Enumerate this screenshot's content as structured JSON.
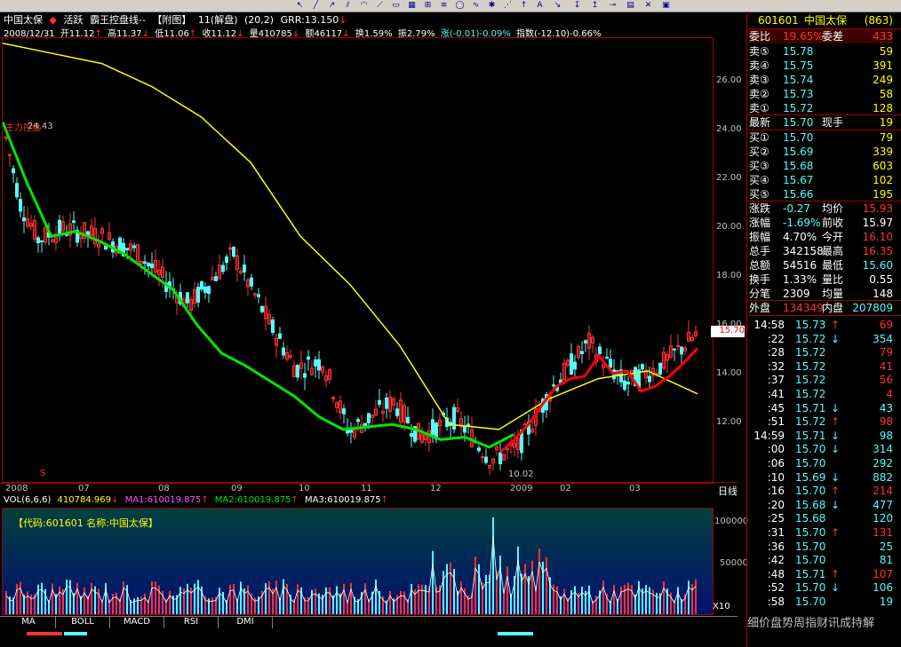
{
  "toolbar": {
    "icons": [
      "pointer-icon",
      "line-icon",
      "ray-icon",
      "channel-icon",
      "arc-icon",
      "fan-icon",
      "text-icon",
      "arrow-icon",
      "box-icon",
      "delete-icon",
      "save-icon"
    ]
  },
  "header": {
    "stock_name": "中国太保",
    "mode": "活跃",
    "indicator_name": "霸王控盘线--",
    "attached": "【附图】",
    "period_info": "11(解盘)",
    "params": "(20,2)",
    "grr": "GRR:13.150",
    "grr_arrow": "↓"
  },
  "info": {
    "date": "2008/12/31",
    "open": "开11.12",
    "open_arrow": "↑",
    "high": "高11.37",
    "high_arrow": "↓",
    "low": "低11.06",
    "low_arrow": "↑",
    "close": "收11.12",
    "close_arrow": "↓",
    "volume": "量410785",
    "volume_arrow": "↓",
    "amount": "额46117",
    "amount_arrow": "↓",
    "turnover": "换1.59%",
    "amplitude": "振2.79%",
    "change": "涨(-0.01)-0.09%",
    "index": "指数(-12.10)-0.66%"
  },
  "chart_marks": {
    "high_label": "24.43",
    "low_label": "10.02",
    "signal_text": "主力控盘",
    "last_price_tag": "15.70",
    "s_marker": "S"
  },
  "chart_data": {
    "type": "line",
    "ylim": [
      10.0,
      27.5
    ],
    "yticks": [
      "26.00",
      "24.00",
      "22.00",
      "20.00",
      "18.00",
      "16.00",
      "14.00",
      "12.00"
    ],
    "x_labels": [
      "2008",
      "07",
      "08",
      "09",
      "10",
      "11",
      "12",
      "2009",
      "02",
      "03",
      "日线"
    ],
    "series": [
      {
        "color": "#ffff00",
        "values": [
          27.3,
          26.9,
          26.5,
          25.6,
          24.4,
          22.6,
          19.7,
          17.8,
          15.4,
          12.3,
          12.1,
          13.3,
          14.1,
          14.4,
          13.5
        ]
      },
      {
        "color": "#00e600",
        "values": [
          24.2,
          21.8,
          19.7,
          19.9,
          19.5,
          19.0,
          18.3,
          17.6,
          16.2,
          15.1,
          14.6,
          14.0,
          13.4,
          12.6,
          12.1,
          12.2,
          12.3,
          12.1,
          11.7,
          11.8,
          11.4,
          11.9
        ]
      },
      {
        "color": "#ff0000",
        "values": [
          11.2,
          11.7,
          12.3,
          13.1,
          13.8,
          14.1,
          14.2,
          15.0,
          14.3,
          14.4,
          13.6,
          13.8,
          14.2,
          14.7,
          15.3
        ]
      }
    ]
  },
  "volume": {
    "title": "VOL(6,6,6)",
    "value": "410784.969",
    "value_arrow": "↓",
    "ma1": "MA1:610019.875",
    "ma1_arrow": "↑",
    "ma2": "MA2:610019.875",
    "ma2_arrow": "↑",
    "ma3": "MA3:610019.875",
    "ma3_arrow": "↑",
    "code_label": "【代码:601601 名称:中国太保】",
    "axis": [
      "100000",
      "50000",
      "X10"
    ]
  },
  "bottom_tabs": [
    "MA",
    "BOLL",
    "MACD",
    "RSI",
    "DMI"
  ],
  "quote": {
    "code": "601601",
    "name": "中国太保",
    "count": "(863)",
    "weibi_label": "委比",
    "weibi_value": "19.65%",
    "weicha_label": "委差",
    "weicha_value": "433",
    "sells": [
      {
        "label": "卖⑤",
        "price": "15.78",
        "vol": "59"
      },
      {
        "label": "卖④",
        "price": "15.75",
        "vol": "391"
      },
      {
        "label": "卖③",
        "price": "15.74",
        "vol": "249"
      },
      {
        "label": "卖②",
        "price": "15.73",
        "vol": "58"
      },
      {
        "label": "卖①",
        "price": "15.72",
        "vol": "128"
      }
    ],
    "latest_label": "最新",
    "latest_price": "15.70",
    "xianshou_label": "现手",
    "xianshou_value": "19",
    "buys": [
      {
        "label": "买①",
        "price": "15.70",
        "vol": "79"
      },
      {
        "label": "买②",
        "price": "15.69",
        "vol": "339"
      },
      {
        "label": "买③",
        "price": "15.68",
        "vol": "603"
      },
      {
        "label": "买④",
        "price": "15.67",
        "vol": "102"
      },
      {
        "label": "买⑤",
        "price": "15.66",
        "vol": "195"
      }
    ],
    "stats": [
      {
        "l1": "涨跌",
        "v1": "-0.27",
        "l2": "均价",
        "v2": "15.93"
      },
      {
        "l1": "涨幅",
        "v1": "-1.69%",
        "l2": "前收",
        "v2": "15.97"
      },
      {
        "l1": "振幅",
        "v1": "4.70%",
        "l2": "今开",
        "v2": "16.10"
      },
      {
        "l1": "总手",
        "v1": "342158",
        "l2": "最高",
        "v2": "16.35"
      },
      {
        "l1": "总额",
        "v1": "54516",
        "l2": "最低",
        "v2": "15.60"
      },
      {
        "l1": "换手",
        "v1": "1.33%",
        "l2": "量比",
        "v2": "0.55"
      },
      {
        "l1": "分笔",
        "v1": "2309",
        "l2": "均量",
        "v2": "148"
      }
    ],
    "waipan_label": "外盘",
    "waipan_value": "134349",
    "neipan_label": "内盘",
    "neipan_value": "207809",
    "ticks": [
      {
        "t": "14:58",
        "p": "15.73",
        "a": "↑",
        "v": "69",
        "c": "#ff3232"
      },
      {
        "t": ":22",
        "p": "15.72",
        "a": "↓",
        "v": "354",
        "c": "#54fcfc"
      },
      {
        "t": ":28",
        "p": "15.72",
        "a": "",
        "v": "79",
        "c": "#ff3232"
      },
      {
        "t": ":32",
        "p": "15.72",
        "a": "",
        "v": "41",
        "c": "#ff3232"
      },
      {
        "t": ":37",
        "p": "15.72",
        "a": "",
        "v": "56",
        "c": "#ff3232"
      },
      {
        "t": ":41",
        "p": "15.72",
        "a": "",
        "v": "4",
        "c": "#ff3232"
      },
      {
        "t": ":45",
        "p": "15.71",
        "a": "↓",
        "v": "43",
        "c": "#54fcfc"
      },
      {
        "t": ":51",
        "p": "15.72",
        "a": "↑",
        "v": "98",
        "c": "#ff3232"
      },
      {
        "t": "14:59",
        "p": "15.71",
        "a": "↓",
        "v": "98",
        "c": "#54fcfc"
      },
      {
        "t": ":00",
        "p": "15.70",
        "a": "↓",
        "v": "314",
        "c": "#54fcfc"
      },
      {
        "t": ":06",
        "p": "15.70",
        "a": "",
        "v": "292",
        "c": "#54fcfc"
      },
      {
        "t": ":10",
        "p": "15.69",
        "a": "↓",
        "v": "882",
        "c": "#54fcfc"
      },
      {
        "t": ":16",
        "p": "15.70",
        "a": "↑",
        "v": "214",
        "c": "#ff3232"
      },
      {
        "t": ":20",
        "p": "15.68",
        "a": "↓",
        "v": "477",
        "c": "#54fcfc"
      },
      {
        "t": ":25",
        "p": "15.68",
        "a": "",
        "v": "120",
        "c": "#54fcfc"
      },
      {
        "t": ":31",
        "p": "15.70",
        "a": "↑",
        "v": "131",
        "c": "#ff3232"
      },
      {
        "t": ":36",
        "p": "15.70",
        "a": "",
        "v": "25",
        "c": "#54fcfc"
      },
      {
        "t": ":42",
        "p": "15.70",
        "a": "",
        "v": "81",
        "c": "#54fcfc"
      },
      {
        "t": ":48",
        "p": "15.71",
        "a": "↑",
        "v": "107",
        "c": "#ff3232"
      },
      {
        "t": ":52",
        "p": "15.70",
        "a": "↓",
        "v": "106",
        "c": "#54fcfc"
      },
      {
        "t": ":58",
        "p": "15.70",
        "a": "",
        "v": "19",
        "c": "#54fcfc"
      }
    ],
    "footer": "细价盘势周指财讯成持解"
  },
  "colors": {
    "up": "#ff3232",
    "down": "#54fcfc",
    "frame": "#a00000",
    "yellow": "#ffff00",
    "green": "#00e600"
  }
}
